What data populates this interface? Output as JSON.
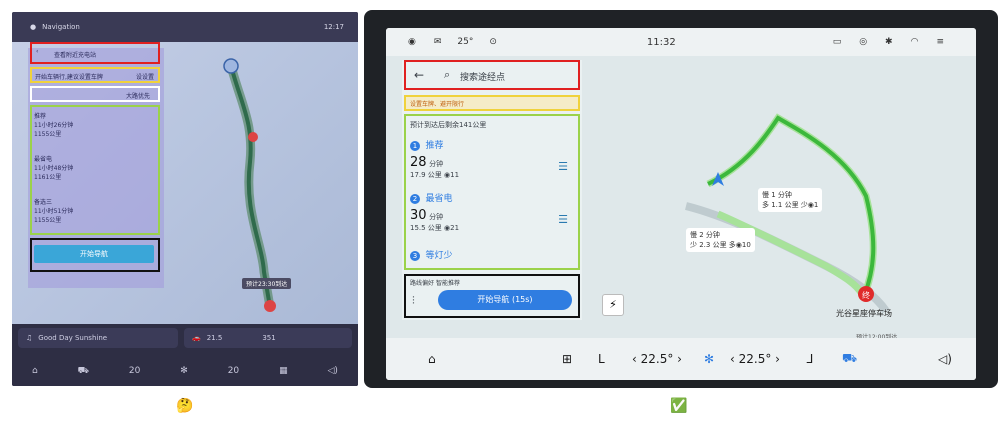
{
  "left": {
    "status_text": "Navigation",
    "status_time": "12:17",
    "search_placeholder": "查看附近充电站",
    "pref_text": "开始车辆行,建议设置车牌",
    "pref_link": "设设置",
    "sort_label": "大路优先",
    "routes": [
      {
        "name": "推荐",
        "time": "11小时26分钟",
        "detail": "1155公里"
      },
      {
        "name": "最省电",
        "time": "11小时48分钟",
        "detail": "1161公里"
      },
      {
        "name": "备选三",
        "time": "11小时51分钟",
        "detail": "1155公里"
      }
    ],
    "start_label": "开始导航",
    "arrival": "预计23:30到达",
    "music": "Good Day Sunshine",
    "range_a": "21.5",
    "range_b": "351",
    "temp_left": "20",
    "temp_right": "20"
  },
  "right": {
    "status_time": "11:32",
    "status_temp": "25°",
    "search_placeholder": "搜索途经点",
    "plate_hint": "设置车牌、避开限行",
    "battery_hint": "预计到达后剩余141公里",
    "routes": [
      {
        "index": "1",
        "name": "推荐",
        "time": "28",
        "unit": "分钟",
        "detail": "17.9 公里 ◉11"
      },
      {
        "index": "2",
        "name": "最省电",
        "time": "30",
        "unit": "分钟",
        "detail": "15.5 公里 ◉21"
      },
      {
        "index": "3",
        "name": "等灯少",
        "time": "",
        "unit": "",
        "detail": ""
      }
    ],
    "pref_label": "路线偏好",
    "pref_value": "智能推荐",
    "start_label": "开始导航 (15s)",
    "map_labels": {
      "r1": "慢 1 分钟",
      "r1_sub": "多 1.1 公里 少◉1",
      "r2": "慢 2 分钟",
      "r2_sub": "少 2.3 公里 多◉10",
      "dest": "光谷星座停车场",
      "dest_marker": "终",
      "eta": "预计12:00到达"
    },
    "temp_left": "22.5°",
    "temp_right": "22.5°"
  },
  "captions": {
    "left": "🤔",
    "right": "✅"
  },
  "colors": {
    "red": "#e02020",
    "yellow": "#f0d23c",
    "green": "#9bd24a",
    "black": "#111111",
    "blue": "#2f7de1",
    "route_green": "#3cb83c"
  }
}
